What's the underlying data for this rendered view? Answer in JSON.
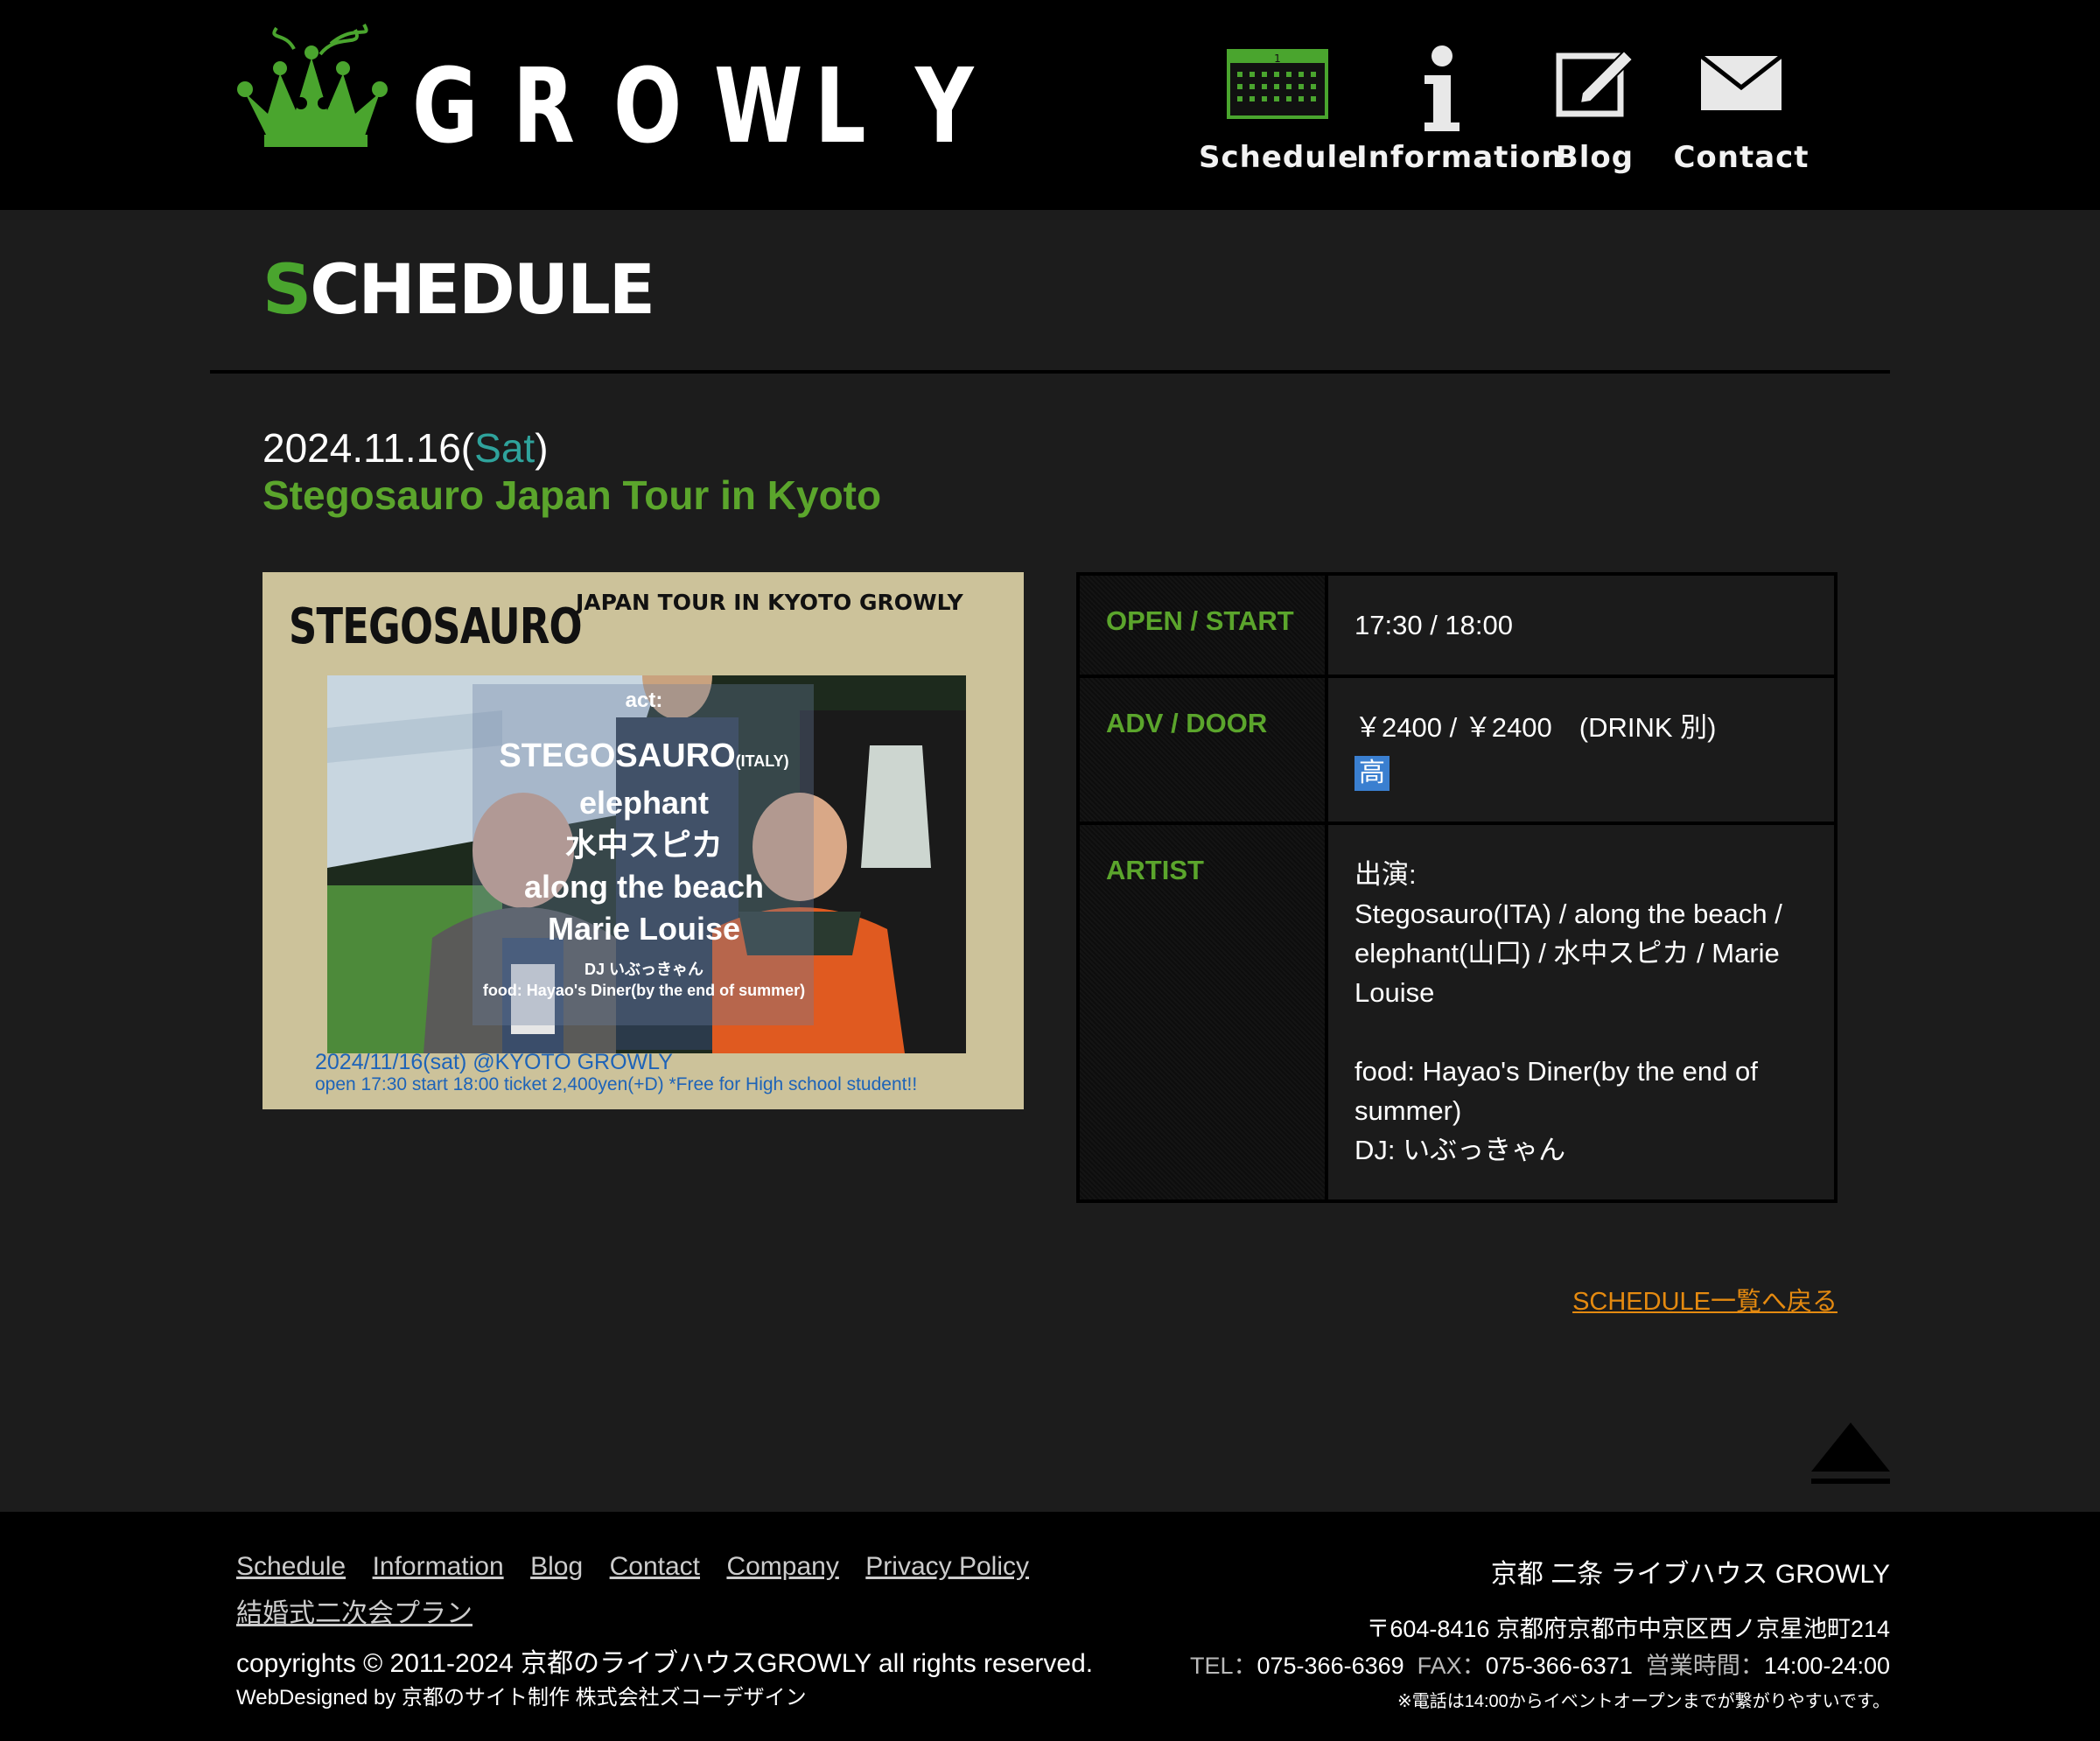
{
  "header": {
    "logo_text": "GROWLY",
    "logo_letters": [
      "G",
      "R",
      "O",
      "W",
      "L",
      "Y"
    ],
    "nav": [
      {
        "label": "Schedule",
        "icon": "calendar-icon"
      },
      {
        "label": "Information",
        "icon": "info-icon"
      },
      {
        "label": "Blog",
        "icon": "pencil-note-icon"
      },
      {
        "label": "Contact",
        "icon": "envelope-icon"
      }
    ]
  },
  "page": {
    "section_title_first": "S",
    "section_title_rest": "CHEDULE"
  },
  "event": {
    "date": "2024.11.16(",
    "dow": "Sat",
    "date_close": ")",
    "title": "Stegosauro Japan Tour in Kyoto"
  },
  "flyer": {
    "brand": "STEGOSAURO",
    "tour": "JAPAN TOUR IN KYOTO GROWLY",
    "act_label": "act:",
    "headliner": "STEGOSAURO",
    "headliner_note": "(ITALY)",
    "lineup": [
      "elephant",
      "水中スピカ",
      "along the beach",
      "Marie Louise"
    ],
    "dj": "DJ いぶっきゃん",
    "food": "food: Hayao's Diner(by the end of summer)",
    "bottom_line1": "2024/11/16(sat) @KYOTO GROWLY",
    "bottom_line2": "open 17:30 start 18:00 ticket 2,400yen(+D) *Free for High school student!!"
  },
  "details": {
    "open_start_label": "OPEN / START",
    "open_start_value": "17:30 / 18:00",
    "price_label": "ADV / DOOR",
    "price_value": "￥2400 / ￥2400　(DRINK 別)",
    "price_badge": "高",
    "artist_label": "ARTIST",
    "artist_lines": [
      "出演:",
      "Stegosauro(ITA) / along the beach /",
      "elephant(山口) / 水中スピカ / Marie",
      "Louise",
      "",
      "food: Hayao's Diner(by the end of",
      "summer)",
      "DJ: いぶっきゃん"
    ]
  },
  "back_link": "SCHEDULE一覧へ戻る",
  "footer": {
    "links": [
      "Schedule",
      "Information",
      "Blog",
      "Contact",
      "Company",
      "Privacy Policy",
      "結婚式二次会プラン"
    ],
    "copyright": "copyrights © 2011-2024 京都のライブハウスGROWLY all rights reserved.",
    "webdesigned": "WebDesigned by 京都のサイト制作 株式会社ズコーデザイン",
    "venue_name": "京都 二条 ライブハウス GROWLY",
    "address": "〒604-8416 京都府京都市中京区西ノ京星池町214",
    "tel_label": "TEL：",
    "tel": "075-366-6369",
    "fax_label": "FAX：",
    "fax": "075-366-6371",
    "hours_label": "営業時間：",
    "hours": "14:00-24:00",
    "note": "※電話は14:00からイベントオープンまでが繋がりやすいです。"
  },
  "colors": {
    "accent_green": "#5ba52c",
    "dow_teal": "#2fa39c",
    "link_orange": "#e58a10",
    "badge_blue": "#3a7fd0"
  }
}
